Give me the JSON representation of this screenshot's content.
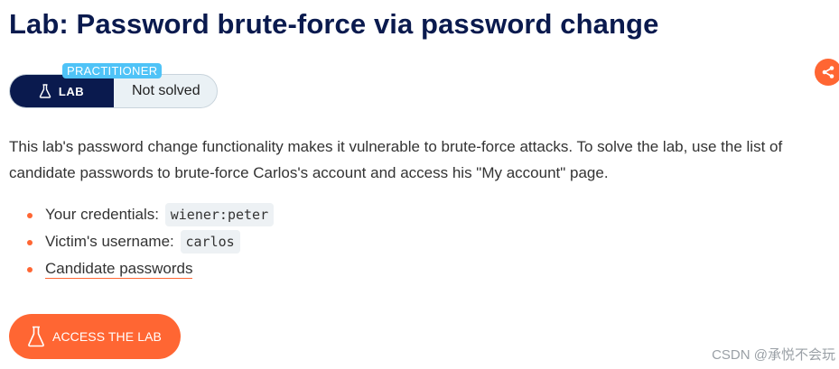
{
  "page": {
    "title": "Lab: Password brute-force via password change"
  },
  "status": {
    "level": "PRACTITIONER",
    "lab_label": "LAB",
    "state": "Not solved"
  },
  "description": "This lab's password change functionality makes it vulnerable to brute-force attacks. To solve the lab, use the list of candidate passwords to brute-force Carlos's account and access his \"My account\" page.",
  "details": {
    "credentials_label": "Your credentials:",
    "credentials_value": "wiener:peter",
    "victim_label": "Victim's username:",
    "victim_value": "carlos",
    "candidates_link": "Candidate passwords"
  },
  "actions": {
    "access_label": "ACCESS THE LAB"
  },
  "icons": {
    "share": "share-icon",
    "flask": "flask-icon"
  },
  "colors": {
    "title": "#0a1a4e",
    "accent": "#ff6633",
    "badge": "#4fc3f7",
    "lab_tag": "#0a1a4e"
  },
  "watermark": "CSDN @承悦不会玩"
}
